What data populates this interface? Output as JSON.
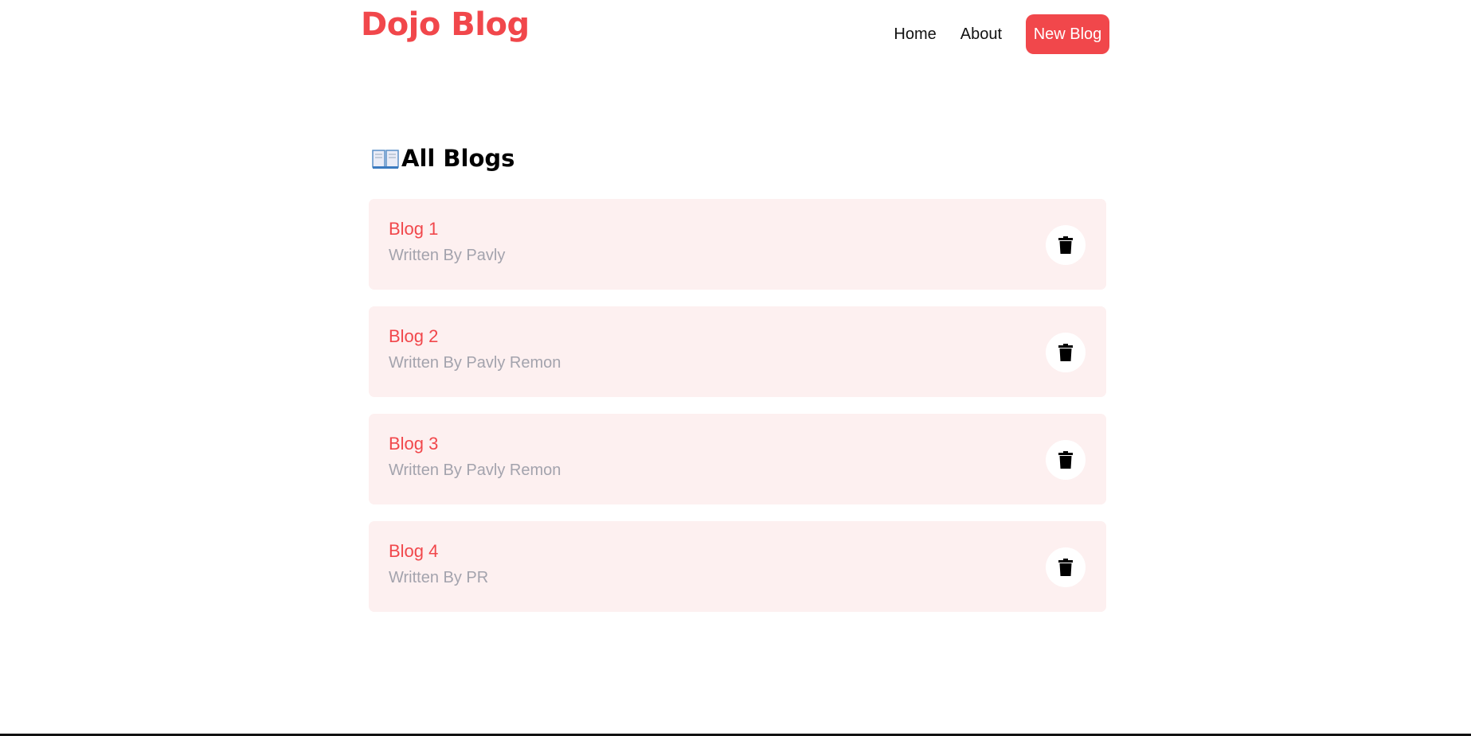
{
  "navbar": {
    "logo": "Dojo Blog",
    "links": [
      {
        "label": "Home"
      },
      {
        "label": "About"
      }
    ],
    "cta_label": "New Blog"
  },
  "main": {
    "heading": "All Blogs",
    "heading_icon": "open-book-icon",
    "blogs": [
      {
        "title": "Blog 1",
        "author": "Written By Pavly",
        "action_icon": "trash-icon"
      },
      {
        "title": "Blog 2",
        "author": "Written By Pavly Remon",
        "action_icon": "trash-icon"
      },
      {
        "title": "Blog 3",
        "author": "Written By Pavly Remon",
        "action_icon": "trash-icon"
      },
      {
        "title": "Blog 4",
        "author": "Written By PR",
        "action_icon": "trash-icon"
      }
    ]
  },
  "colors": {
    "accent": "#f1474b",
    "card_bg": "#fdf0f0",
    "muted_text": "#a3a3ad"
  }
}
